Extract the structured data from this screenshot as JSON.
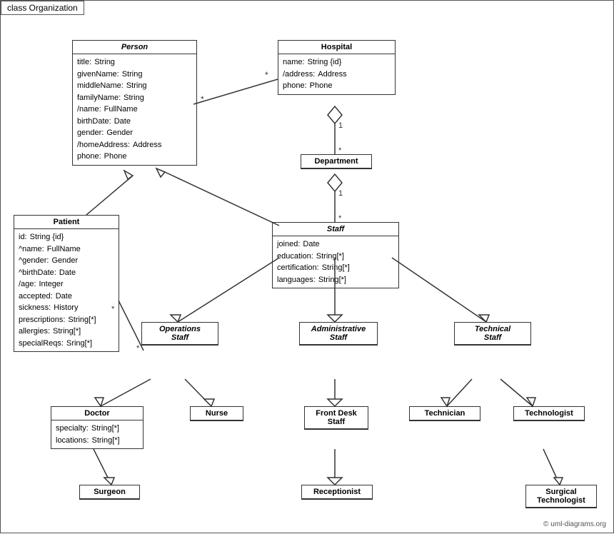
{
  "title": "class Organization",
  "copyright": "© uml-diagrams.org",
  "boxes": {
    "person": {
      "title": "Person",
      "italic": true,
      "attrs": [
        [
          "title:",
          "String"
        ],
        [
          "givenName:",
          "String"
        ],
        [
          "middleName:",
          "String"
        ],
        [
          "familyName:",
          "String"
        ],
        [
          "/name:",
          "FullName"
        ],
        [
          "birthDate:",
          "Date"
        ],
        [
          "gender:",
          "Gender"
        ],
        [
          "/homeAddress:",
          "Address"
        ],
        [
          "phone:",
          "Phone"
        ]
      ]
    },
    "hospital": {
      "title": "Hospital",
      "italic": false,
      "attrs": [
        [
          "name:",
          "String {id}"
        ],
        [
          "/address:",
          "Address"
        ],
        [
          "phone:",
          "Phone"
        ]
      ]
    },
    "department": {
      "title": "Department",
      "italic": false,
      "attrs": []
    },
    "staff": {
      "title": "Staff",
      "italic": true,
      "attrs": [
        [
          "joined:",
          "Date"
        ],
        [
          "education:",
          "String[*]"
        ],
        [
          "certification:",
          "String[*]"
        ],
        [
          "languages:",
          "String[*]"
        ]
      ]
    },
    "patient": {
      "title": "Patient",
      "italic": false,
      "attrs": [
        [
          "id:",
          "String {id}"
        ],
        [
          "^name:",
          "FullName"
        ],
        [
          "^gender:",
          "Gender"
        ],
        [
          "^birthDate:",
          "Date"
        ],
        [
          "/age:",
          "Integer"
        ],
        [
          "accepted:",
          "Date"
        ],
        [
          "sickness:",
          "History"
        ],
        [
          "prescriptions:",
          "String[*]"
        ],
        [
          "allergies:",
          "String[*]"
        ],
        [
          "specialReqs:",
          "Sring[*]"
        ]
      ]
    },
    "operations_staff": {
      "title": "Operations\nStaff",
      "italic": true,
      "attrs": []
    },
    "administrative_staff": {
      "title": "Administrative\nStaff",
      "italic": true,
      "attrs": []
    },
    "technical_staff": {
      "title": "Technical\nStaff",
      "italic": true,
      "attrs": []
    },
    "doctor": {
      "title": "Doctor",
      "italic": false,
      "attrs": [
        [
          "specialty:",
          "String[*]"
        ],
        [
          "locations:",
          "String[*]"
        ]
      ]
    },
    "nurse": {
      "title": "Nurse",
      "italic": false,
      "attrs": []
    },
    "front_desk_staff": {
      "title": "Front Desk\nStaff",
      "italic": false,
      "attrs": []
    },
    "technician": {
      "title": "Technician",
      "italic": false,
      "attrs": []
    },
    "technologist": {
      "title": "Technologist",
      "italic": false,
      "attrs": []
    },
    "surgeon": {
      "title": "Surgeon",
      "italic": false,
      "attrs": []
    },
    "receptionist": {
      "title": "Receptionist",
      "italic": false,
      "attrs": []
    },
    "surgical_technologist": {
      "title": "Surgical\nTechnologist",
      "italic": false,
      "attrs": []
    }
  },
  "labels": {
    "star1": "*",
    "star2": "*",
    "one1": "1",
    "one2": "1",
    "star3": "*",
    "star4": "*"
  }
}
